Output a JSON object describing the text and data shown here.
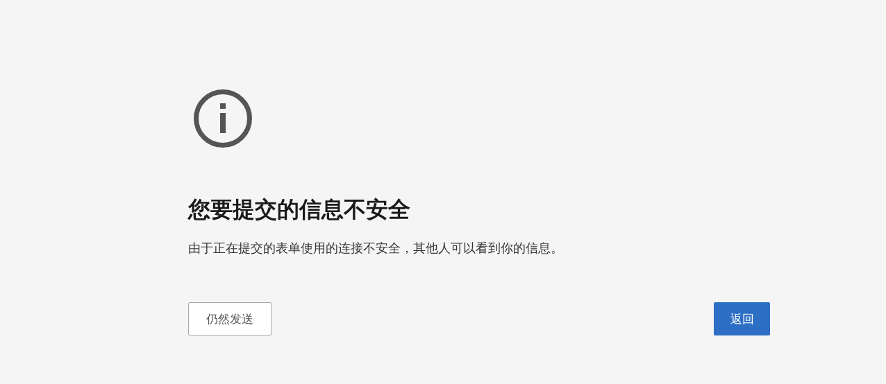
{
  "title": "您要提交的信息不安全",
  "message": "由于正在提交的表单使用的连接不安全，其他人可以看到你的信息。",
  "buttons": [
    {
      "label": "仍然发送",
      "kind": "secondary"
    },
    {
      "label": "返回",
      "kind": "primary"
    }
  ]
}
